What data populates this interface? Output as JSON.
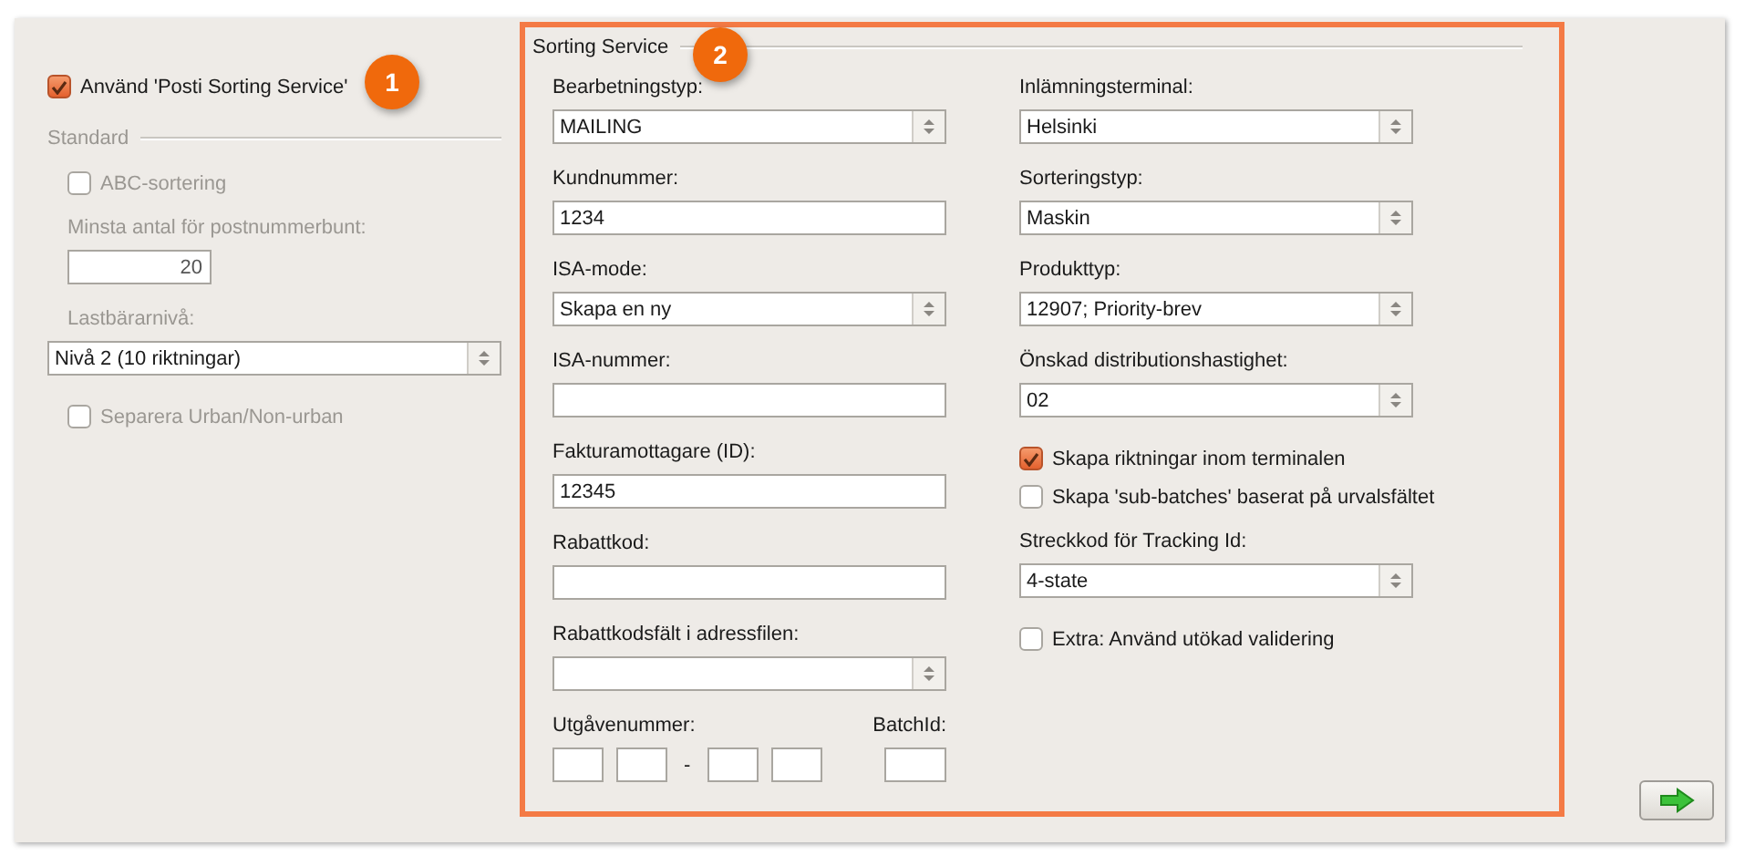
{
  "use_service": {
    "label": "Använd 'Posti Sorting Service'",
    "checked": true
  },
  "callouts": [
    {
      "label": "1"
    },
    {
      "label": "2"
    }
  ],
  "standard": {
    "title": "Standard",
    "disabled": true,
    "items": [
      {
        "kind": "checkbox",
        "label": "ABC-sortering",
        "checked": false
      },
      {
        "kind": "number",
        "label": "Minsta antal för postnummerbunt:",
        "value": "20"
      },
      {
        "kind": "select",
        "label": "Lastbärarnivå:",
        "value": "Nivå 2 (10 riktningar)"
      },
      {
        "kind": "checkbox",
        "label": "Separera Urban/Non-urban",
        "checked": false
      }
    ]
  },
  "sorting_service": {
    "title": "Sorting Service",
    "left": [
      {
        "kind": "select",
        "label": "Bearbetningstyp:",
        "value": "MAILING"
      },
      {
        "kind": "text",
        "label": "Kundnummer:",
        "value": "1234"
      },
      {
        "kind": "select",
        "label": "ISA-mode:",
        "value": "Skapa en ny"
      },
      {
        "kind": "text",
        "label": "ISA-nummer:"
      },
      {
        "kind": "text",
        "label": "Fakturamottagare (ID):",
        "value": "12345"
      },
      {
        "kind": "text",
        "label": "Rabattkod:"
      },
      {
        "kind": "select",
        "label": "Rabattkodsfält i adressfilen:"
      },
      {
        "kind": "edition",
        "label": "Utgåvenummer:",
        "separator": "-",
        "batch_label": "BatchId:"
      }
    ],
    "right": [
      {
        "kind": "select",
        "label": "Inlämningsterminal:",
        "value": "Helsinki"
      },
      {
        "kind": "select",
        "label": "Sorteringstyp:",
        "value": "Maskin"
      },
      {
        "kind": "select",
        "label": "Produkttyp:",
        "value": "12907; Priority-brev"
      },
      {
        "kind": "select",
        "label": "Önskad distributionshastighet:",
        "value": "02"
      },
      {
        "kind": "checkbox",
        "label": "Skapa riktningar inom terminalen",
        "checked": true
      },
      {
        "kind": "checkbox",
        "label": "Skapa 'sub-batches' baserat på urvalsfältet",
        "checked": false
      },
      {
        "kind": "select",
        "label": "Streckkod för Tracking Id:",
        "value": "4-state"
      },
      {
        "kind": "checkbox",
        "label": "Extra: Använd utökad validering",
        "checked": false
      }
    ]
  }
}
